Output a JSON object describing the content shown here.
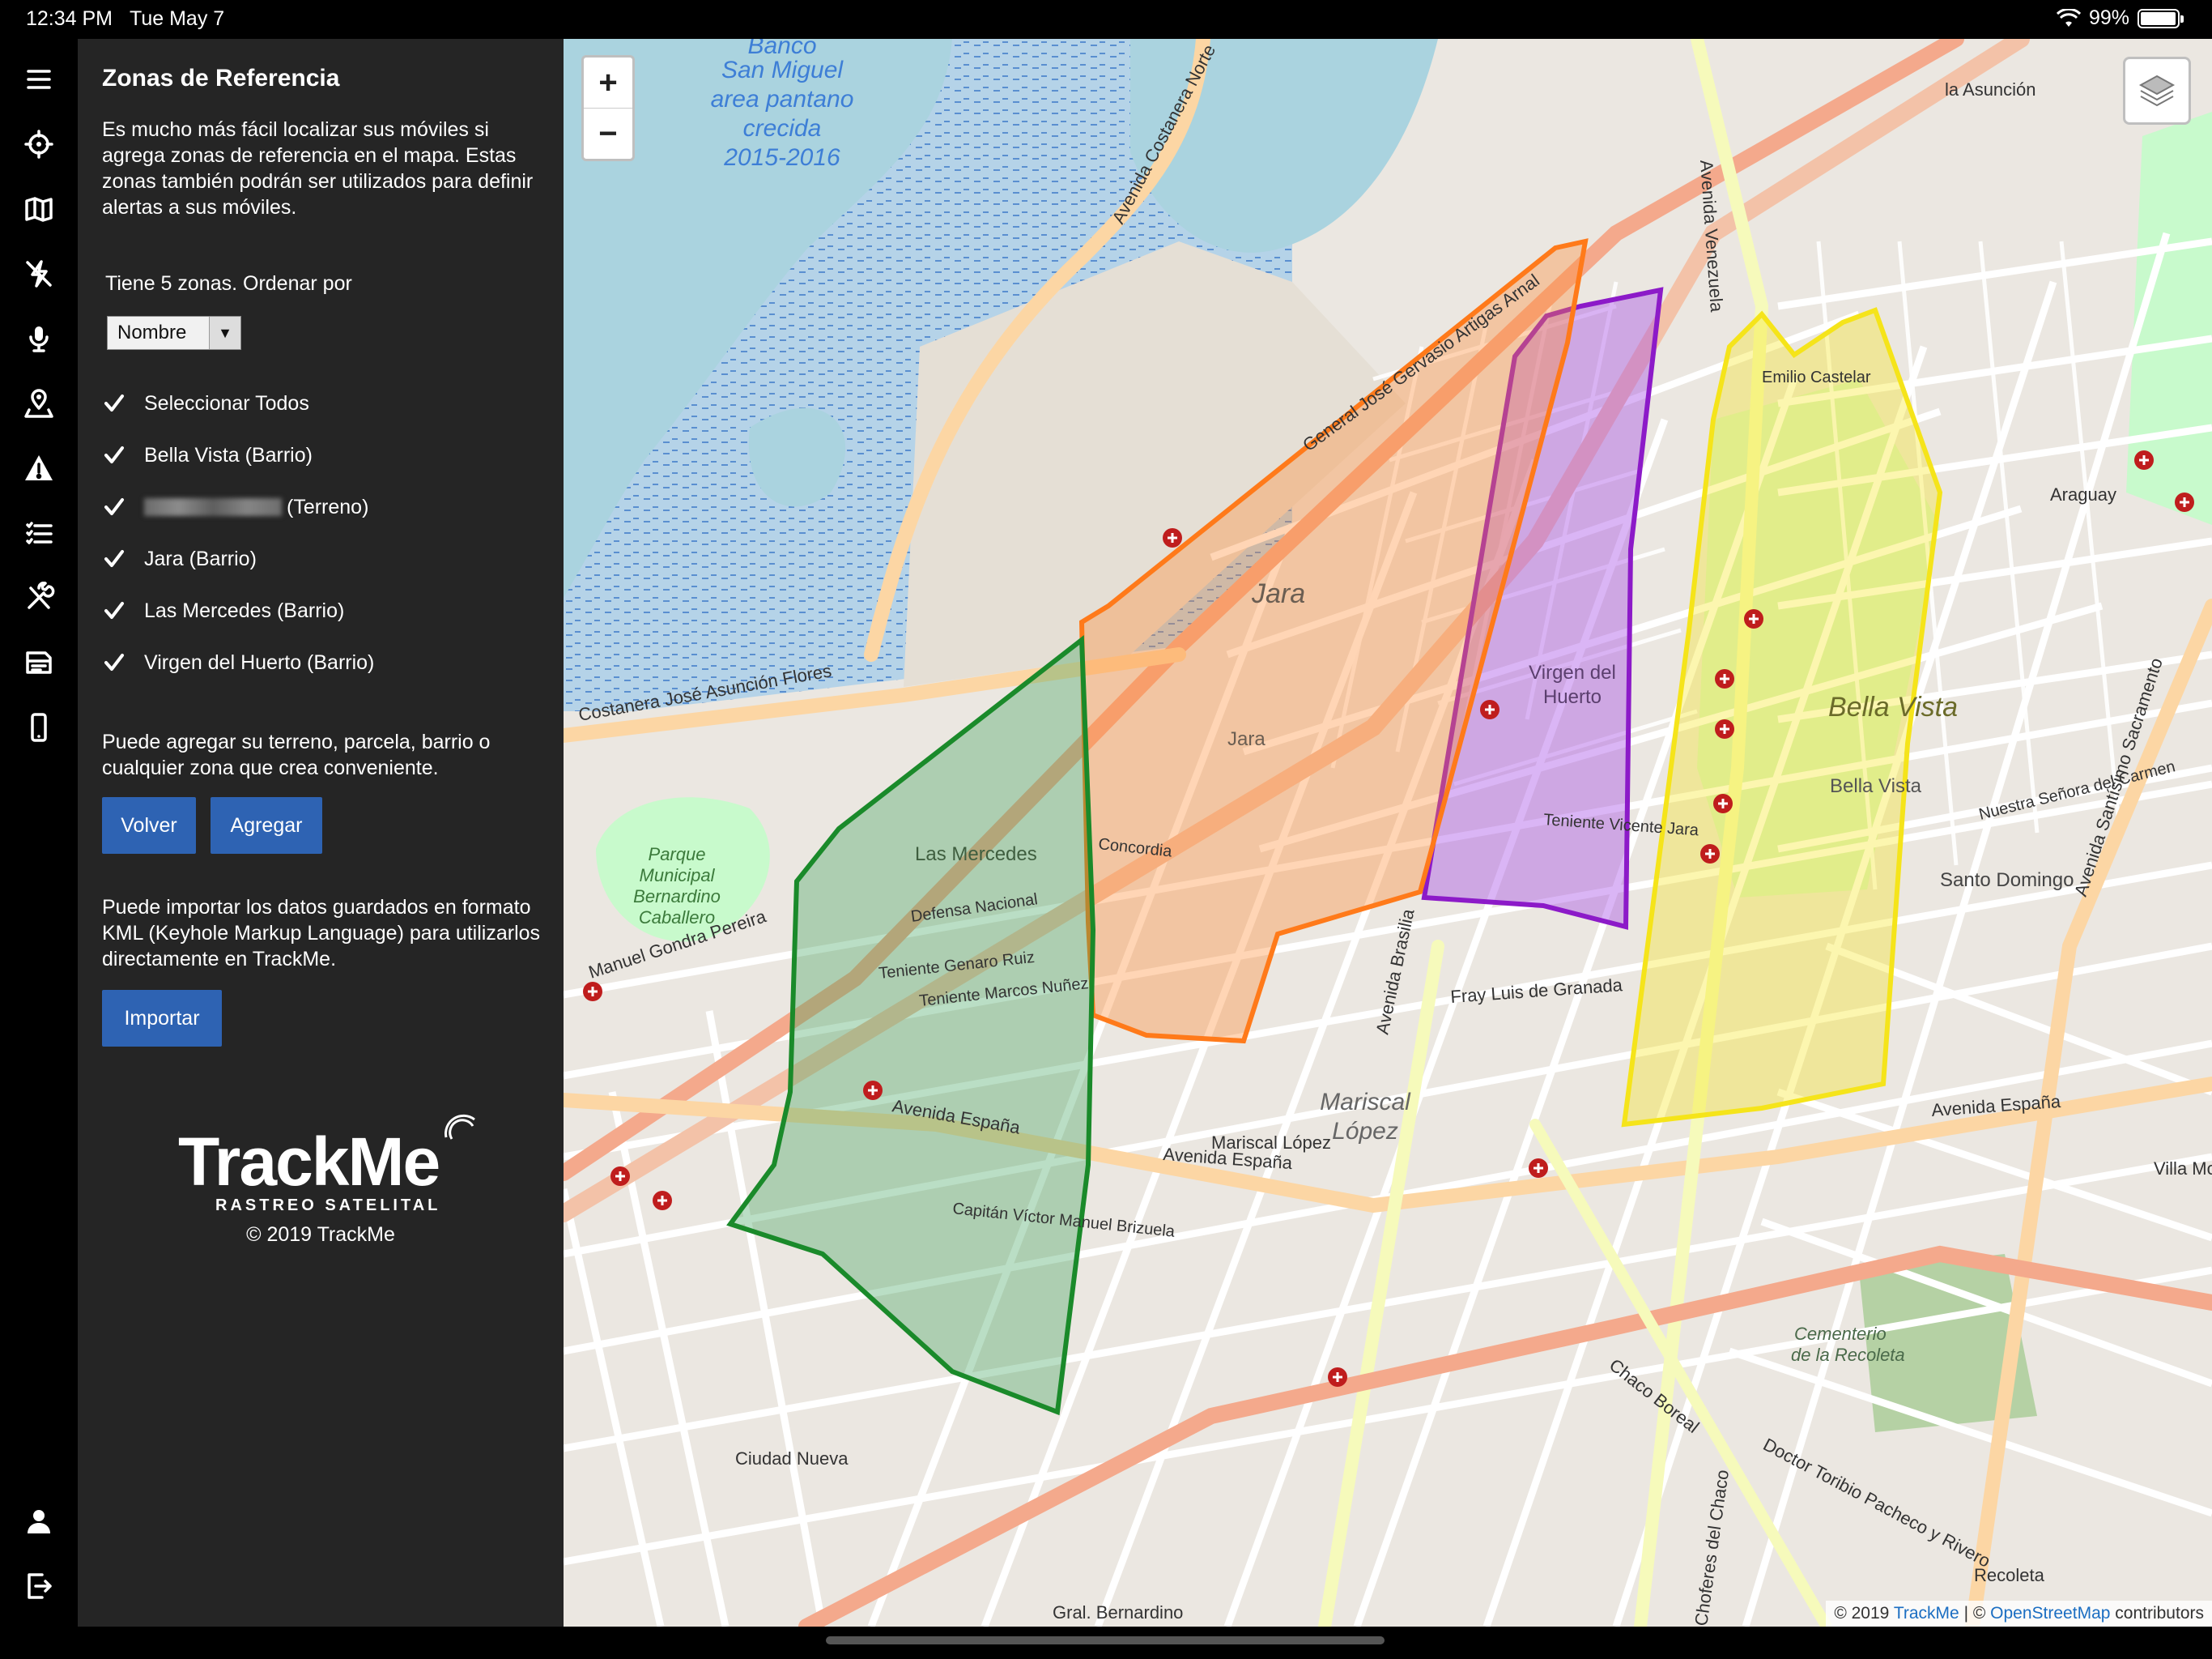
{
  "status_bar": {
    "time": "12:34 PM",
    "date": "Tue May 7",
    "battery": "99%"
  },
  "rail": {
    "items": [
      "menu-icon",
      "locate-icon",
      "map-icon",
      "alerts-icon",
      "microphone-icon",
      "zone-icon",
      "warning-icon",
      "list-icon",
      "tools-icon",
      "reports-icon",
      "device-icon",
      "user-icon",
      "logout-icon"
    ]
  },
  "panel": {
    "title": "Zonas de Referencia",
    "intro": "Es mucho más fácil localizar sus móviles si agrega zonas de referencia en el mapa. Estas zonas también podrán ser utilizados para definir alertas a sus móviles.",
    "sort_label": "Tiene 5 zonas. Ordenar por",
    "sort_value": "Nombre",
    "select_all": "Seleccionar Todos",
    "zones": [
      {
        "label": "Bella Vista (Barrio)",
        "checked": true
      },
      {
        "label": "(Terreno)",
        "checked": true,
        "redacted": true
      },
      {
        "label": "Jara (Barrio)",
        "checked": true
      },
      {
        "label": "Las Mercedes (Barrio)",
        "checked": true
      },
      {
        "label": "Virgen del Huerto (Barrio)",
        "checked": true
      }
    ],
    "add_text": "Puede agregar su terreno, parcela, barrio o cualquier zona que crea conveniente.",
    "back_button": "Volver",
    "add_button": "Agregar",
    "import_text": "Puede importar los datos guardados en formato KML (Keyhole Markup Language) para utilizarlos directamente en TrackMe.",
    "import_button": "Importar",
    "logo_word": "TrackMe",
    "logo_sub": "RASTREO SATELITAL",
    "copyright": "© 2019 TrackMe"
  },
  "map": {
    "zoom_in": "+",
    "zoom_out": "−",
    "attribution_prefix": "© 2019",
    "attribution_link1": "TrackMe",
    "attribution_mid": "| ©",
    "attribution_link2": "OpenStreetMap",
    "attribution_suffix": "contributors",
    "zone_colors": {
      "las_mercedes": "#1a8a2a",
      "jara": "#ff7a1a",
      "virgen_del_huerto": "#8c1ac8",
      "bella_vista": "#f5e41a"
    },
    "labels": {
      "banco": "Banco San Miguel area pantano crecida 2015-2016",
      "jara": "Jara",
      "jara2": "Jara",
      "virgen": "Virgen del Huerto",
      "bella_vista": "Bella Vista",
      "bella_vista_small": "Bella Vista",
      "las_mercedes": "Las Mercedes",
      "mariscal": "Mariscal López",
      "parque": "Parque Municipal Bernardino Caballero",
      "santo_domingo": "Santo Domingo",
      "cementerio": "Cementerio de la Recoleta",
      "av_espana": "Avenida España",
      "av_espana2": "Avenida España",
      "av_espana3": "Avenida España",
      "av_venezuela": "Avenida Venezuela",
      "av_brasilia": "Avenida Brasilia",
      "costanera": "Costanera José Asunción Flores",
      "av_costanera_norte": "Avenida Costanera Norte",
      "gral_artigas": "General José Gervasio Artigas Arnal",
      "av_santisimo": "Avenida Santísimo Sacramento",
      "doctor_toribio": "Doctor Toribio Pacheco y Rivero",
      "choferes": "Choferes del Chaco",
      "gral_bernardino": "Gral. Bernardino",
      "ciudad_nueva": "Ciudad Nueva",
      "recoleta": "Recoleta",
      "villa_morra": "Villa Morra",
      "mariscal_lopez": "Mariscal López",
      "fray_luis": "Fray Luis de Granada",
      "manuel_gondra": "Manuel Gondra Pereira",
      "la_asuncion": "la Asunción",
      "araguay": "Araguay",
      "teniente_vicente": "Teniente Vicente Jara",
      "defensa": "Defensa Nacional",
      "teniente_genaro": "Teniente Genaro Ruiz",
      "teniente_marcos": "Teniente Marcos Nuñez",
      "concordia": "Concordia",
      "capitan_victor": "Capitán Víctor Manuel Brizuela",
      "chaco_boreal": "Chaco Boreal",
      "emilio_castelar": "Emilio Castelar",
      "nuestra_senora": "Nuestra Señora del Carmen"
    }
  }
}
